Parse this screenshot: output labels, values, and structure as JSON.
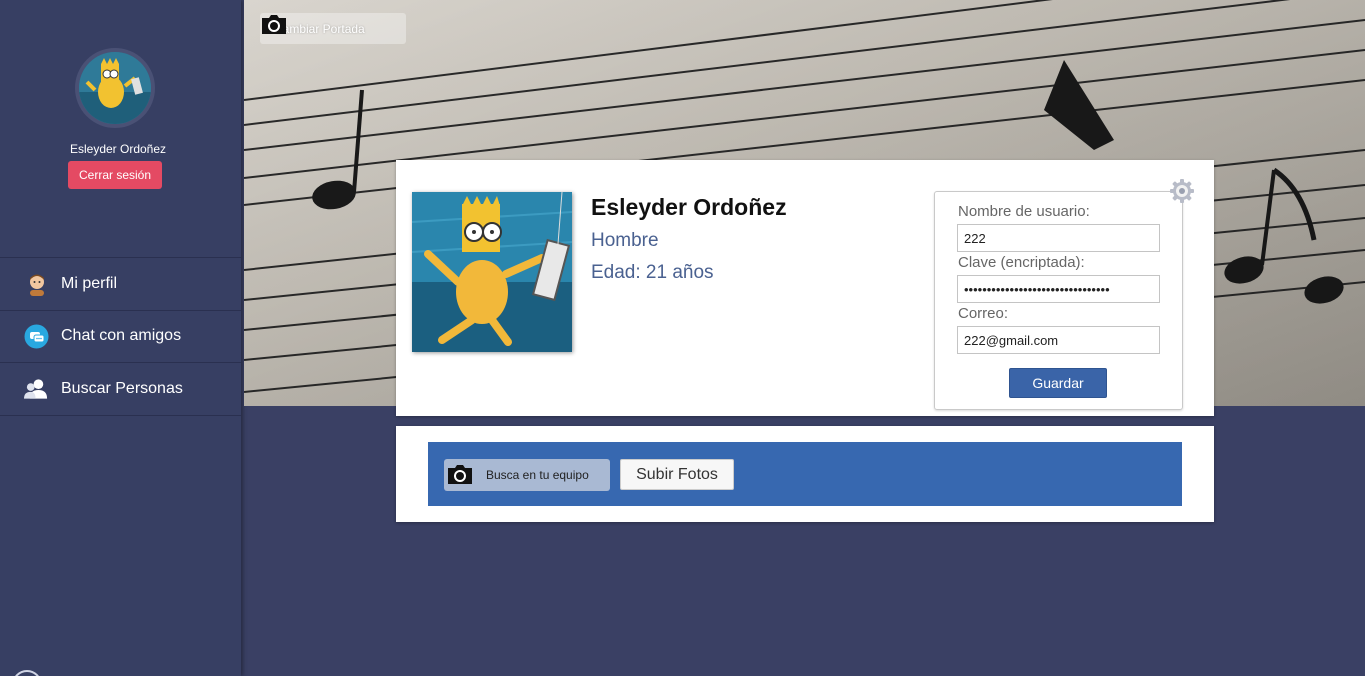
{
  "sidebar": {
    "user_name": "Esleyder Ordoñez",
    "logout_label": "Cerrar sesión",
    "items": [
      {
        "label": "Mi perfil",
        "icon": "user-face-icon"
      },
      {
        "label": "Chat con amigos",
        "icon": "chat-bubble-icon"
      },
      {
        "label": "Buscar Personas",
        "icon": "people-search-icon"
      }
    ]
  },
  "cover": {
    "change_cover_label": "Cambiar Portada"
  },
  "profile": {
    "name": "Esleyder Ordoñez",
    "gender": "Hombre",
    "age": "Edad: 21 años"
  },
  "account_form": {
    "username_label": "Nombre de usuario:",
    "username_value": "222",
    "password_label": "Clave (encriptada):",
    "password_value": "••••••••••••••••••••••••••••••••",
    "email_label": "Correo:",
    "email_value": "222@gmail.com",
    "save_label": "Guardar"
  },
  "upload": {
    "browse_label": "Busca en tu equipo",
    "upload_label": "Subir Fotos"
  },
  "colors": {
    "sidebar_bg": "#373f63",
    "logout_bg": "#e44a63",
    "accent_blue": "#3768b0",
    "save_bg": "#3a64a8"
  }
}
